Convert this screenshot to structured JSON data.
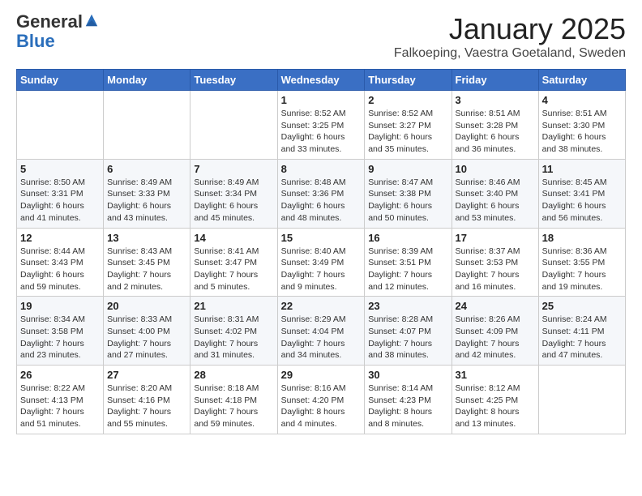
{
  "logo": {
    "general": "General",
    "blue": "Blue"
  },
  "header": {
    "month": "January 2025",
    "location": "Falkoeping, Vaestra Goetaland, Sweden"
  },
  "weekdays": [
    "Sunday",
    "Monday",
    "Tuesday",
    "Wednesday",
    "Thursday",
    "Friday",
    "Saturday"
  ],
  "weeks": [
    [
      {
        "day": "",
        "info": ""
      },
      {
        "day": "",
        "info": ""
      },
      {
        "day": "",
        "info": ""
      },
      {
        "day": "1",
        "info": "Sunrise: 8:52 AM\nSunset: 3:25 PM\nDaylight: 6 hours and 33 minutes."
      },
      {
        "day": "2",
        "info": "Sunrise: 8:52 AM\nSunset: 3:27 PM\nDaylight: 6 hours and 35 minutes."
      },
      {
        "day": "3",
        "info": "Sunrise: 8:51 AM\nSunset: 3:28 PM\nDaylight: 6 hours and 36 minutes."
      },
      {
        "day": "4",
        "info": "Sunrise: 8:51 AM\nSunset: 3:30 PM\nDaylight: 6 hours and 38 minutes."
      }
    ],
    [
      {
        "day": "5",
        "info": "Sunrise: 8:50 AM\nSunset: 3:31 PM\nDaylight: 6 hours and 41 minutes."
      },
      {
        "day": "6",
        "info": "Sunrise: 8:49 AM\nSunset: 3:33 PM\nDaylight: 6 hours and 43 minutes."
      },
      {
        "day": "7",
        "info": "Sunrise: 8:49 AM\nSunset: 3:34 PM\nDaylight: 6 hours and 45 minutes."
      },
      {
        "day": "8",
        "info": "Sunrise: 8:48 AM\nSunset: 3:36 PM\nDaylight: 6 hours and 48 minutes."
      },
      {
        "day": "9",
        "info": "Sunrise: 8:47 AM\nSunset: 3:38 PM\nDaylight: 6 hours and 50 minutes."
      },
      {
        "day": "10",
        "info": "Sunrise: 8:46 AM\nSunset: 3:40 PM\nDaylight: 6 hours and 53 minutes."
      },
      {
        "day": "11",
        "info": "Sunrise: 8:45 AM\nSunset: 3:41 PM\nDaylight: 6 hours and 56 minutes."
      }
    ],
    [
      {
        "day": "12",
        "info": "Sunrise: 8:44 AM\nSunset: 3:43 PM\nDaylight: 6 hours and 59 minutes."
      },
      {
        "day": "13",
        "info": "Sunrise: 8:43 AM\nSunset: 3:45 PM\nDaylight: 7 hours and 2 minutes."
      },
      {
        "day": "14",
        "info": "Sunrise: 8:41 AM\nSunset: 3:47 PM\nDaylight: 7 hours and 5 minutes."
      },
      {
        "day": "15",
        "info": "Sunrise: 8:40 AM\nSunset: 3:49 PM\nDaylight: 7 hours and 9 minutes."
      },
      {
        "day": "16",
        "info": "Sunrise: 8:39 AM\nSunset: 3:51 PM\nDaylight: 7 hours and 12 minutes."
      },
      {
        "day": "17",
        "info": "Sunrise: 8:37 AM\nSunset: 3:53 PM\nDaylight: 7 hours and 16 minutes."
      },
      {
        "day": "18",
        "info": "Sunrise: 8:36 AM\nSunset: 3:55 PM\nDaylight: 7 hours and 19 minutes."
      }
    ],
    [
      {
        "day": "19",
        "info": "Sunrise: 8:34 AM\nSunset: 3:58 PM\nDaylight: 7 hours and 23 minutes."
      },
      {
        "day": "20",
        "info": "Sunrise: 8:33 AM\nSunset: 4:00 PM\nDaylight: 7 hours and 27 minutes."
      },
      {
        "day": "21",
        "info": "Sunrise: 8:31 AM\nSunset: 4:02 PM\nDaylight: 7 hours and 31 minutes."
      },
      {
        "day": "22",
        "info": "Sunrise: 8:29 AM\nSunset: 4:04 PM\nDaylight: 7 hours and 34 minutes."
      },
      {
        "day": "23",
        "info": "Sunrise: 8:28 AM\nSunset: 4:07 PM\nDaylight: 7 hours and 38 minutes."
      },
      {
        "day": "24",
        "info": "Sunrise: 8:26 AM\nSunset: 4:09 PM\nDaylight: 7 hours and 42 minutes."
      },
      {
        "day": "25",
        "info": "Sunrise: 8:24 AM\nSunset: 4:11 PM\nDaylight: 7 hours and 47 minutes."
      }
    ],
    [
      {
        "day": "26",
        "info": "Sunrise: 8:22 AM\nSunset: 4:13 PM\nDaylight: 7 hours and 51 minutes."
      },
      {
        "day": "27",
        "info": "Sunrise: 8:20 AM\nSunset: 4:16 PM\nDaylight: 7 hours and 55 minutes."
      },
      {
        "day": "28",
        "info": "Sunrise: 8:18 AM\nSunset: 4:18 PM\nDaylight: 7 hours and 59 minutes."
      },
      {
        "day": "29",
        "info": "Sunrise: 8:16 AM\nSunset: 4:20 PM\nDaylight: 8 hours and 4 minutes."
      },
      {
        "day": "30",
        "info": "Sunrise: 8:14 AM\nSunset: 4:23 PM\nDaylight: 8 hours and 8 minutes."
      },
      {
        "day": "31",
        "info": "Sunrise: 8:12 AM\nSunset: 4:25 PM\nDaylight: 8 hours and 13 minutes."
      },
      {
        "day": "",
        "info": ""
      }
    ]
  ]
}
